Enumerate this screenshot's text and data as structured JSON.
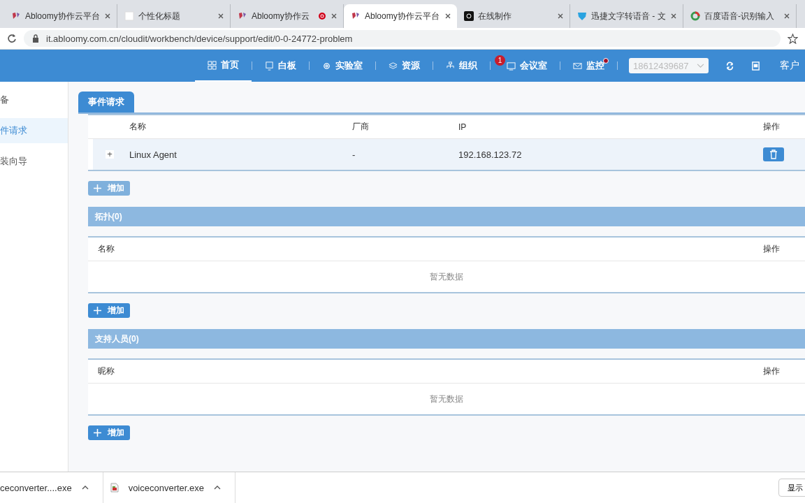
{
  "browser": {
    "tabs": [
      {
        "title": "Abloomy协作云平台",
        "selected": false,
        "kind": "logo",
        "recording": false
      },
      {
        "title": "个性化标题",
        "selected": false,
        "kind": "blank",
        "recording": false
      },
      {
        "title": "Abloomy协作云",
        "selected": false,
        "kind": "logo",
        "recording": true
      },
      {
        "title": "Abloomy协作云平台",
        "selected": true,
        "kind": "logo",
        "recording": false
      },
      {
        "title": "在线制作",
        "selected": false,
        "kind": "dark",
        "recording": false
      },
      {
        "title": "迅捷文字转语音 - 文",
        "selected": false,
        "kind": "shield",
        "recording": false
      },
      {
        "title": "百度语音-识别输入",
        "selected": false,
        "kind": "ring",
        "recording": false
      }
    ],
    "url": "it.abloomy.com.cn/cloudit/workbench/device/support/edit/0-0-24772-problem"
  },
  "nav": {
    "items": [
      {
        "label": "首页",
        "kind": "grid",
        "selected": true,
        "dot": false
      },
      {
        "label": "白板",
        "kind": "screen",
        "selected": false,
        "dot": false
      },
      {
        "label": "实验室",
        "kind": "gear",
        "selected": false,
        "dot": false
      },
      {
        "label": "资源",
        "kind": "layers",
        "selected": false,
        "dot": false
      },
      {
        "label": "组织",
        "kind": "org",
        "selected": false,
        "dot": false
      },
      {
        "label": "会议室",
        "kind": "room",
        "selected": false,
        "badge": "1",
        "dot": false
      },
      {
        "label": "监控",
        "kind": "mail",
        "selected": false,
        "dot": true
      }
    ],
    "account": "18612439687",
    "customer": "客户"
  },
  "sidebar": {
    "items": [
      {
        "label": "备",
        "selected": false
      },
      {
        "label": "件请求",
        "selected": true
      },
      {
        "label": "装向导",
        "selected": false
      }
    ]
  },
  "panel_tab": "事件请求",
  "devices": {
    "columns": [
      "名称",
      "厂商",
      "IP",
      "操作"
    ],
    "rows": [
      {
        "name": "Linux Agent",
        "vendor": "-",
        "ip": "192.168.123.72",
        "expand": "+"
      }
    ],
    "add": "增加"
  },
  "sections": [
    {
      "title": "拓扑(0)",
      "columns": [
        "名称",
        "操作"
      ],
      "empty": "暂无数据",
      "add": "增加"
    },
    {
      "title": "支持人员(0)",
      "columns": [
        "昵称",
        "操作"
      ],
      "empty": "暂无数据",
      "add": "增加"
    }
  ],
  "downloads": {
    "files": [
      "ceconverter....exe",
      "voiceconverter.exe"
    ],
    "show_all": "显示"
  }
}
